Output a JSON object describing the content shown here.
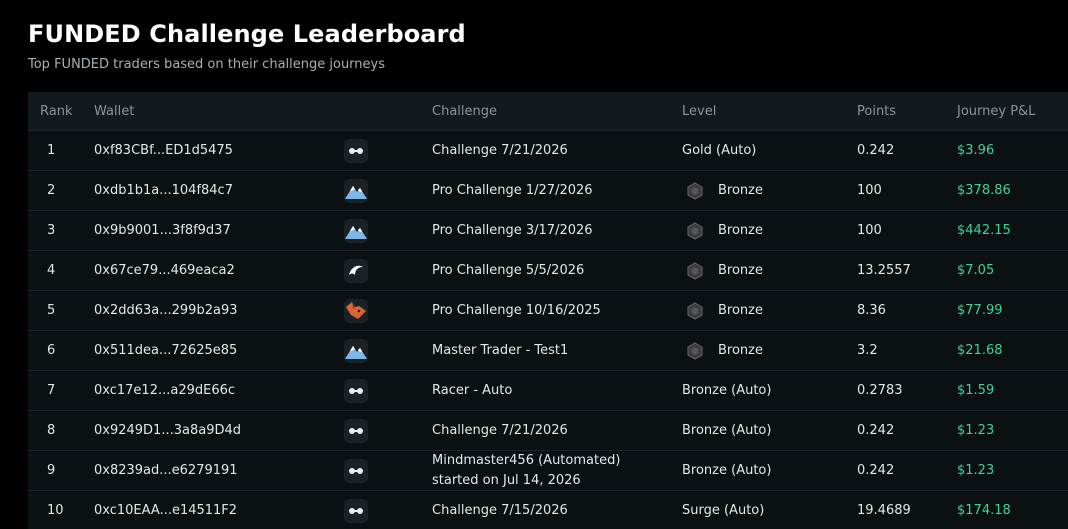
{
  "page": {
    "title": "FUNDED Challenge Leaderboard",
    "subtitle": "Top FUNDED traders based on their challenge journeys"
  },
  "columns": {
    "rank": "Rank",
    "wallet": "Wallet",
    "challenge": "Challenge",
    "level": "Level",
    "points": "Points",
    "pnl": "Journey P&L"
  },
  "colors": {
    "pnl_positive": "#3fd49a",
    "background": "#000000",
    "table_bg": "#0b1012",
    "header_bg": "#131a1d"
  },
  "rows": [
    {
      "rank": "1",
      "wallet": "0xf83CBf...ED1d5475",
      "icon": "infinity-icon",
      "challenge": "Challenge 7/21/2026",
      "challenge2": "",
      "level": "Gold (Auto)",
      "level_badge": false,
      "points": "0.242",
      "pnl": "$3.96"
    },
    {
      "rank": "2",
      "wallet": "0xdb1b1a...104f84c7",
      "icon": "mountain-icon",
      "challenge": "Pro Challenge 1/27/2026",
      "challenge2": "",
      "level": "Bronze",
      "level_badge": true,
      "points": "100",
      "pnl": "$378.86"
    },
    {
      "rank": "3",
      "wallet": "0x9b9001...3f8f9d37",
      "icon": "mountain-icon",
      "challenge": "Pro Challenge 3/17/2026",
      "challenge2": "",
      "level": "Bronze",
      "level_badge": true,
      "points": "100",
      "pnl": "$442.15"
    },
    {
      "rank": "4",
      "wallet": "0x67ce79...469eaca2",
      "icon": "swoosh-icon",
      "challenge": "Pro Challenge 5/5/2026",
      "challenge2": "",
      "level": "Bronze",
      "level_badge": true,
      "points": "13.2557",
      "pnl": "$7.05"
    },
    {
      "rank": "5",
      "wallet": "0x2dd63a...299b2a93",
      "icon": "fox-icon",
      "challenge": "Pro Challenge 10/16/2025",
      "challenge2": "",
      "level": "Bronze",
      "level_badge": true,
      "points": "8.36",
      "pnl": "$77.99"
    },
    {
      "rank": "6",
      "wallet": "0x511dea...72625e85",
      "icon": "mountain-icon",
      "challenge": "Master Trader - Test1",
      "challenge2": "",
      "level": "Bronze",
      "level_badge": true,
      "points": "3.2",
      "pnl": "$21.68"
    },
    {
      "rank": "7",
      "wallet": "0xc17e12...a29dE66c",
      "icon": "infinity-icon",
      "challenge": "Racer - Auto",
      "challenge2": "",
      "level": "Bronze (Auto)",
      "level_badge": false,
      "points": "0.2783",
      "pnl": "$1.59"
    },
    {
      "rank": "8",
      "wallet": "0x9249D1...3a8a9D4d",
      "icon": "infinity-icon",
      "challenge": "Challenge 7/21/2026",
      "challenge2": "",
      "level": "Bronze (Auto)",
      "level_badge": false,
      "points": "0.242",
      "pnl": "$1.23"
    },
    {
      "rank": "9",
      "wallet": "0x8239ad...e6279191",
      "icon": "infinity-icon",
      "challenge": "Mindmaster456 (Automated)",
      "challenge2": "started on Jul 14, 2026",
      "level": "Bronze (Auto)",
      "level_badge": false,
      "points": "0.242",
      "pnl": "$1.23"
    },
    {
      "rank": "10",
      "wallet": "0xc10EAA...e14511F2",
      "icon": "infinity-icon",
      "challenge": "Challenge 7/15/2026",
      "challenge2": "",
      "level": "Surge (Auto)",
      "level_badge": false,
      "points": "19.4689",
      "pnl": "$174.18"
    }
  ]
}
